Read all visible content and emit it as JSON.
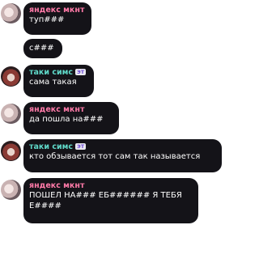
{
  "messages": [
    {
      "author": "яндекс мкнт",
      "badge": "",
      "text": "туп###"
    },
    {
      "author": "",
      "badge": "",
      "text": "с###"
    },
    {
      "author": "таки симс",
      "badge": "ЭТ",
      "text": "сама такая"
    },
    {
      "author": "яндекс мкнт",
      "badge": "",
      "text": "да пошла на###"
    },
    {
      "author": "таки симс",
      "badge": "ЭТ",
      "text": "кто обзывается тот сам так называется"
    },
    {
      "author": "яндекс мкнт",
      "badge": "",
      "text": "ПОШЕЛ НА### ЕБ###### Я ТЕБЯ\nЕ####"
    }
  ],
  "colors": {
    "bubble_bg": "#141318",
    "text": "#ffffff",
    "name_yandex": "#ff7aa8",
    "name_taki": "#5fd8c8",
    "badge_fg": "#6f4bd8"
  }
}
